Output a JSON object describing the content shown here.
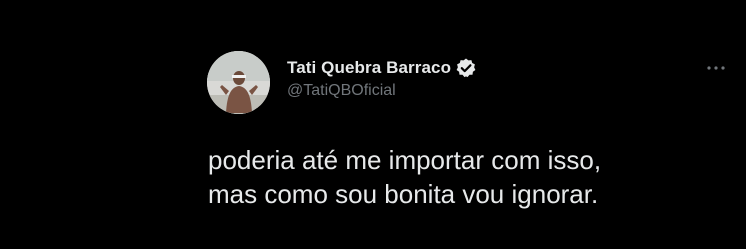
{
  "tweet": {
    "author": {
      "display_name": "Tati Quebra Barraco",
      "handle": "@TatiQBOficial",
      "verified": true,
      "avatar_icon": "profile-photo"
    },
    "text": "poderia até me importar com isso,\nmas como sou bonita vou ignorar.",
    "more_icon": "more-options-icon"
  },
  "colors": {
    "background": "#000000",
    "primary_text": "#e7e9ea",
    "secondary_text": "#71767b",
    "verified_badge": "#e7e9ea"
  }
}
